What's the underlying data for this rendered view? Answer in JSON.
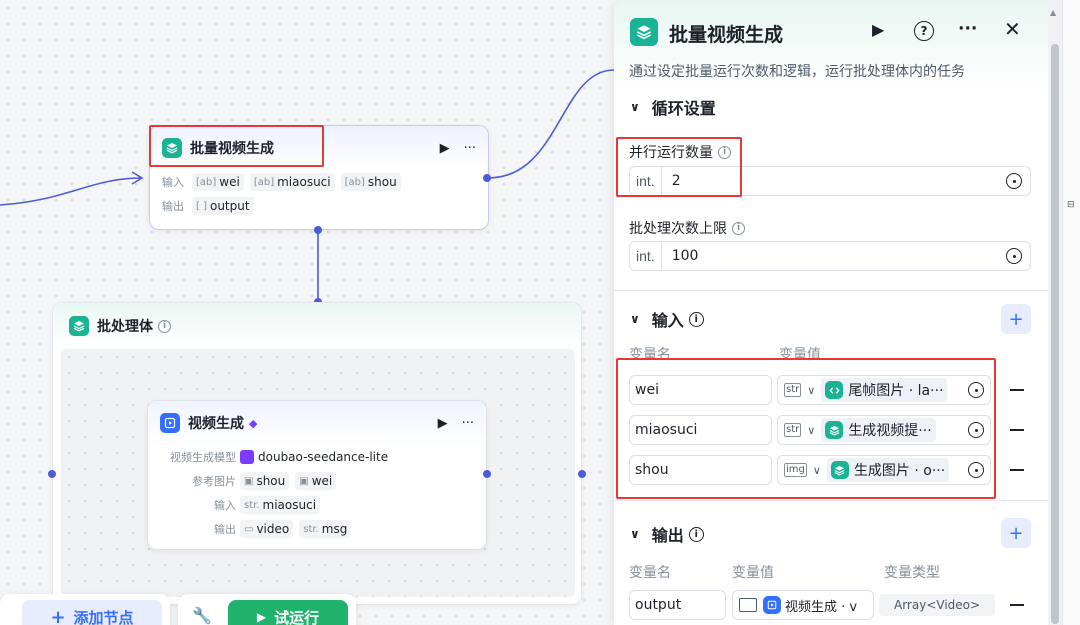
{
  "canvas": {
    "batch_node": {
      "title": "批量视频生成",
      "input_label": "输入",
      "inputs": [
        "wei",
        "miaosuci",
        "shou"
      ],
      "output_label": "输出",
      "outputs": [
        "output"
      ]
    },
    "batch_body": {
      "title": "批处理体",
      "video_node": {
        "title": "视频生成",
        "model_label": "视频生成模型",
        "model": "doubao-seedance-lite",
        "ref_label": "参考图片",
        "refs": [
          "shou",
          "wei"
        ],
        "input_label": "输入",
        "input_type": "str.",
        "input": "miaosuci",
        "output_label": "输出",
        "outputs": [
          {
            "type": "",
            "name": "video"
          },
          {
            "type": "str.",
            "name": "msg"
          }
        ]
      }
    },
    "toolbar": {
      "add_node": "添加节点",
      "run": "试运行"
    }
  },
  "panel": {
    "title": "批量视频生成",
    "description": "通过设定批量运行次数和逻辑，运行批处理体内的任务",
    "loop_section": "循环设置",
    "parallel_label": "并行运行数量",
    "parallel_prefix": "int.",
    "parallel_value": "2",
    "limit_label": "批处理次数上限",
    "limit_prefix": "int.",
    "limit_value": "100",
    "input_section": "输入",
    "input_col_name": "变量名",
    "input_col_value": "变量值",
    "inputs": [
      {
        "name": "wei",
        "type": "str",
        "value": "尾帧图片 · la···",
        "icon": "code"
      },
      {
        "name": "miaosuci",
        "type": "str",
        "value": "生成视频提···",
        "icon": "layers"
      },
      {
        "name": "shou",
        "type": "img",
        "value": "生成图片 · o···",
        "icon": "layers"
      }
    ],
    "output_section": "输出",
    "output_col_name": "变量名",
    "output_col_value": "变量值",
    "output_col_type": "变量类型",
    "outputs": [
      {
        "name": "output",
        "value": "视频生成 · v",
        "type": "Array<Video>"
      }
    ]
  }
}
